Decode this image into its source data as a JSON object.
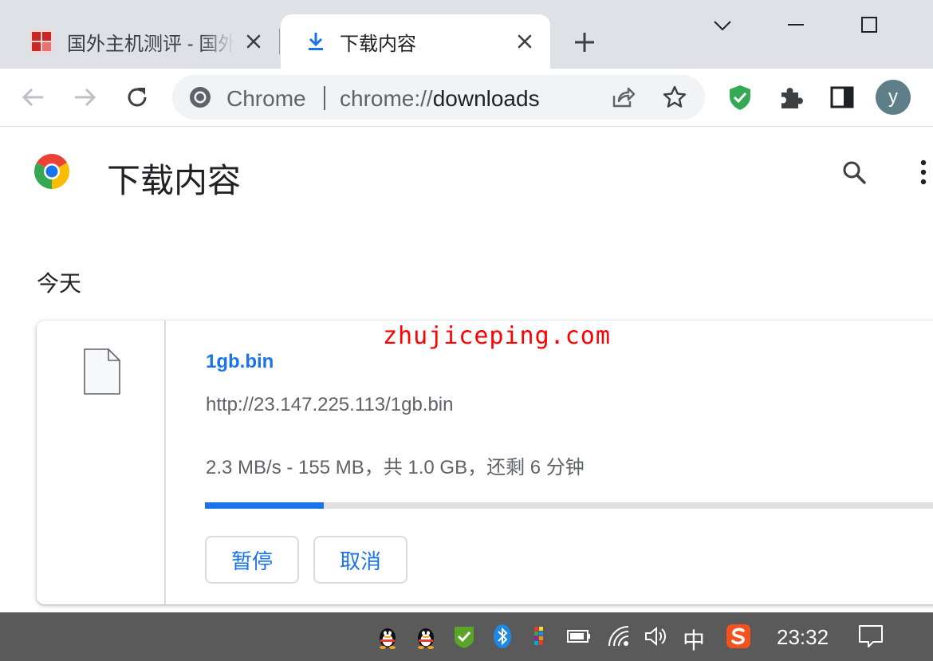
{
  "tabs": [
    {
      "title": "国外主机测评 - 国外",
      "active": false
    },
    {
      "title": "下载内容",
      "active": true
    }
  ],
  "omnibox": {
    "site_label": "Chrome",
    "url_scheme": "chrome://",
    "url_host": "downloads"
  },
  "profile": {
    "initial": "y"
  },
  "page": {
    "title": "下载内容"
  },
  "downloads": {
    "section_label": "今天",
    "items": [
      {
        "file_name": "1gb.bin",
        "url": "http://23.147.225.113/1gb.bin",
        "status": "2.3 MB/s - 155 MB，共 1.0 GB，还剩 6 分钟",
        "progress_percent": 15.5,
        "pause_label": "暂停",
        "cancel_label": "取消"
      }
    ]
  },
  "watermark": "zhujiceping.com",
  "taskbar": {
    "ime": "中",
    "clock": "23:32"
  },
  "colors": {
    "accent": "#1a73e8",
    "tabbar": "#dee1e6",
    "taskbar": "#5a5a5a",
    "watermark": "#ff0000"
  },
  "icons": [
    "site-favicon-icon",
    "download-icon",
    "close-icon",
    "plus-icon",
    "chevron-down-icon",
    "minimize-icon",
    "maximize-icon",
    "back-arrow-icon",
    "forward-arrow-icon",
    "reload-icon",
    "chrome-logo-icon",
    "share-icon",
    "star-icon",
    "shield-check-icon",
    "puzzle-icon",
    "side-panel-icon",
    "search-icon",
    "more-vertical-icon",
    "file-icon",
    "qq-penguin-icon",
    "security-check-icon",
    "bluetooth-icon",
    "color-grid-icon",
    "battery-icon",
    "wifi-icon",
    "volume-icon",
    "sogou-ime-icon",
    "notification-icon"
  ]
}
